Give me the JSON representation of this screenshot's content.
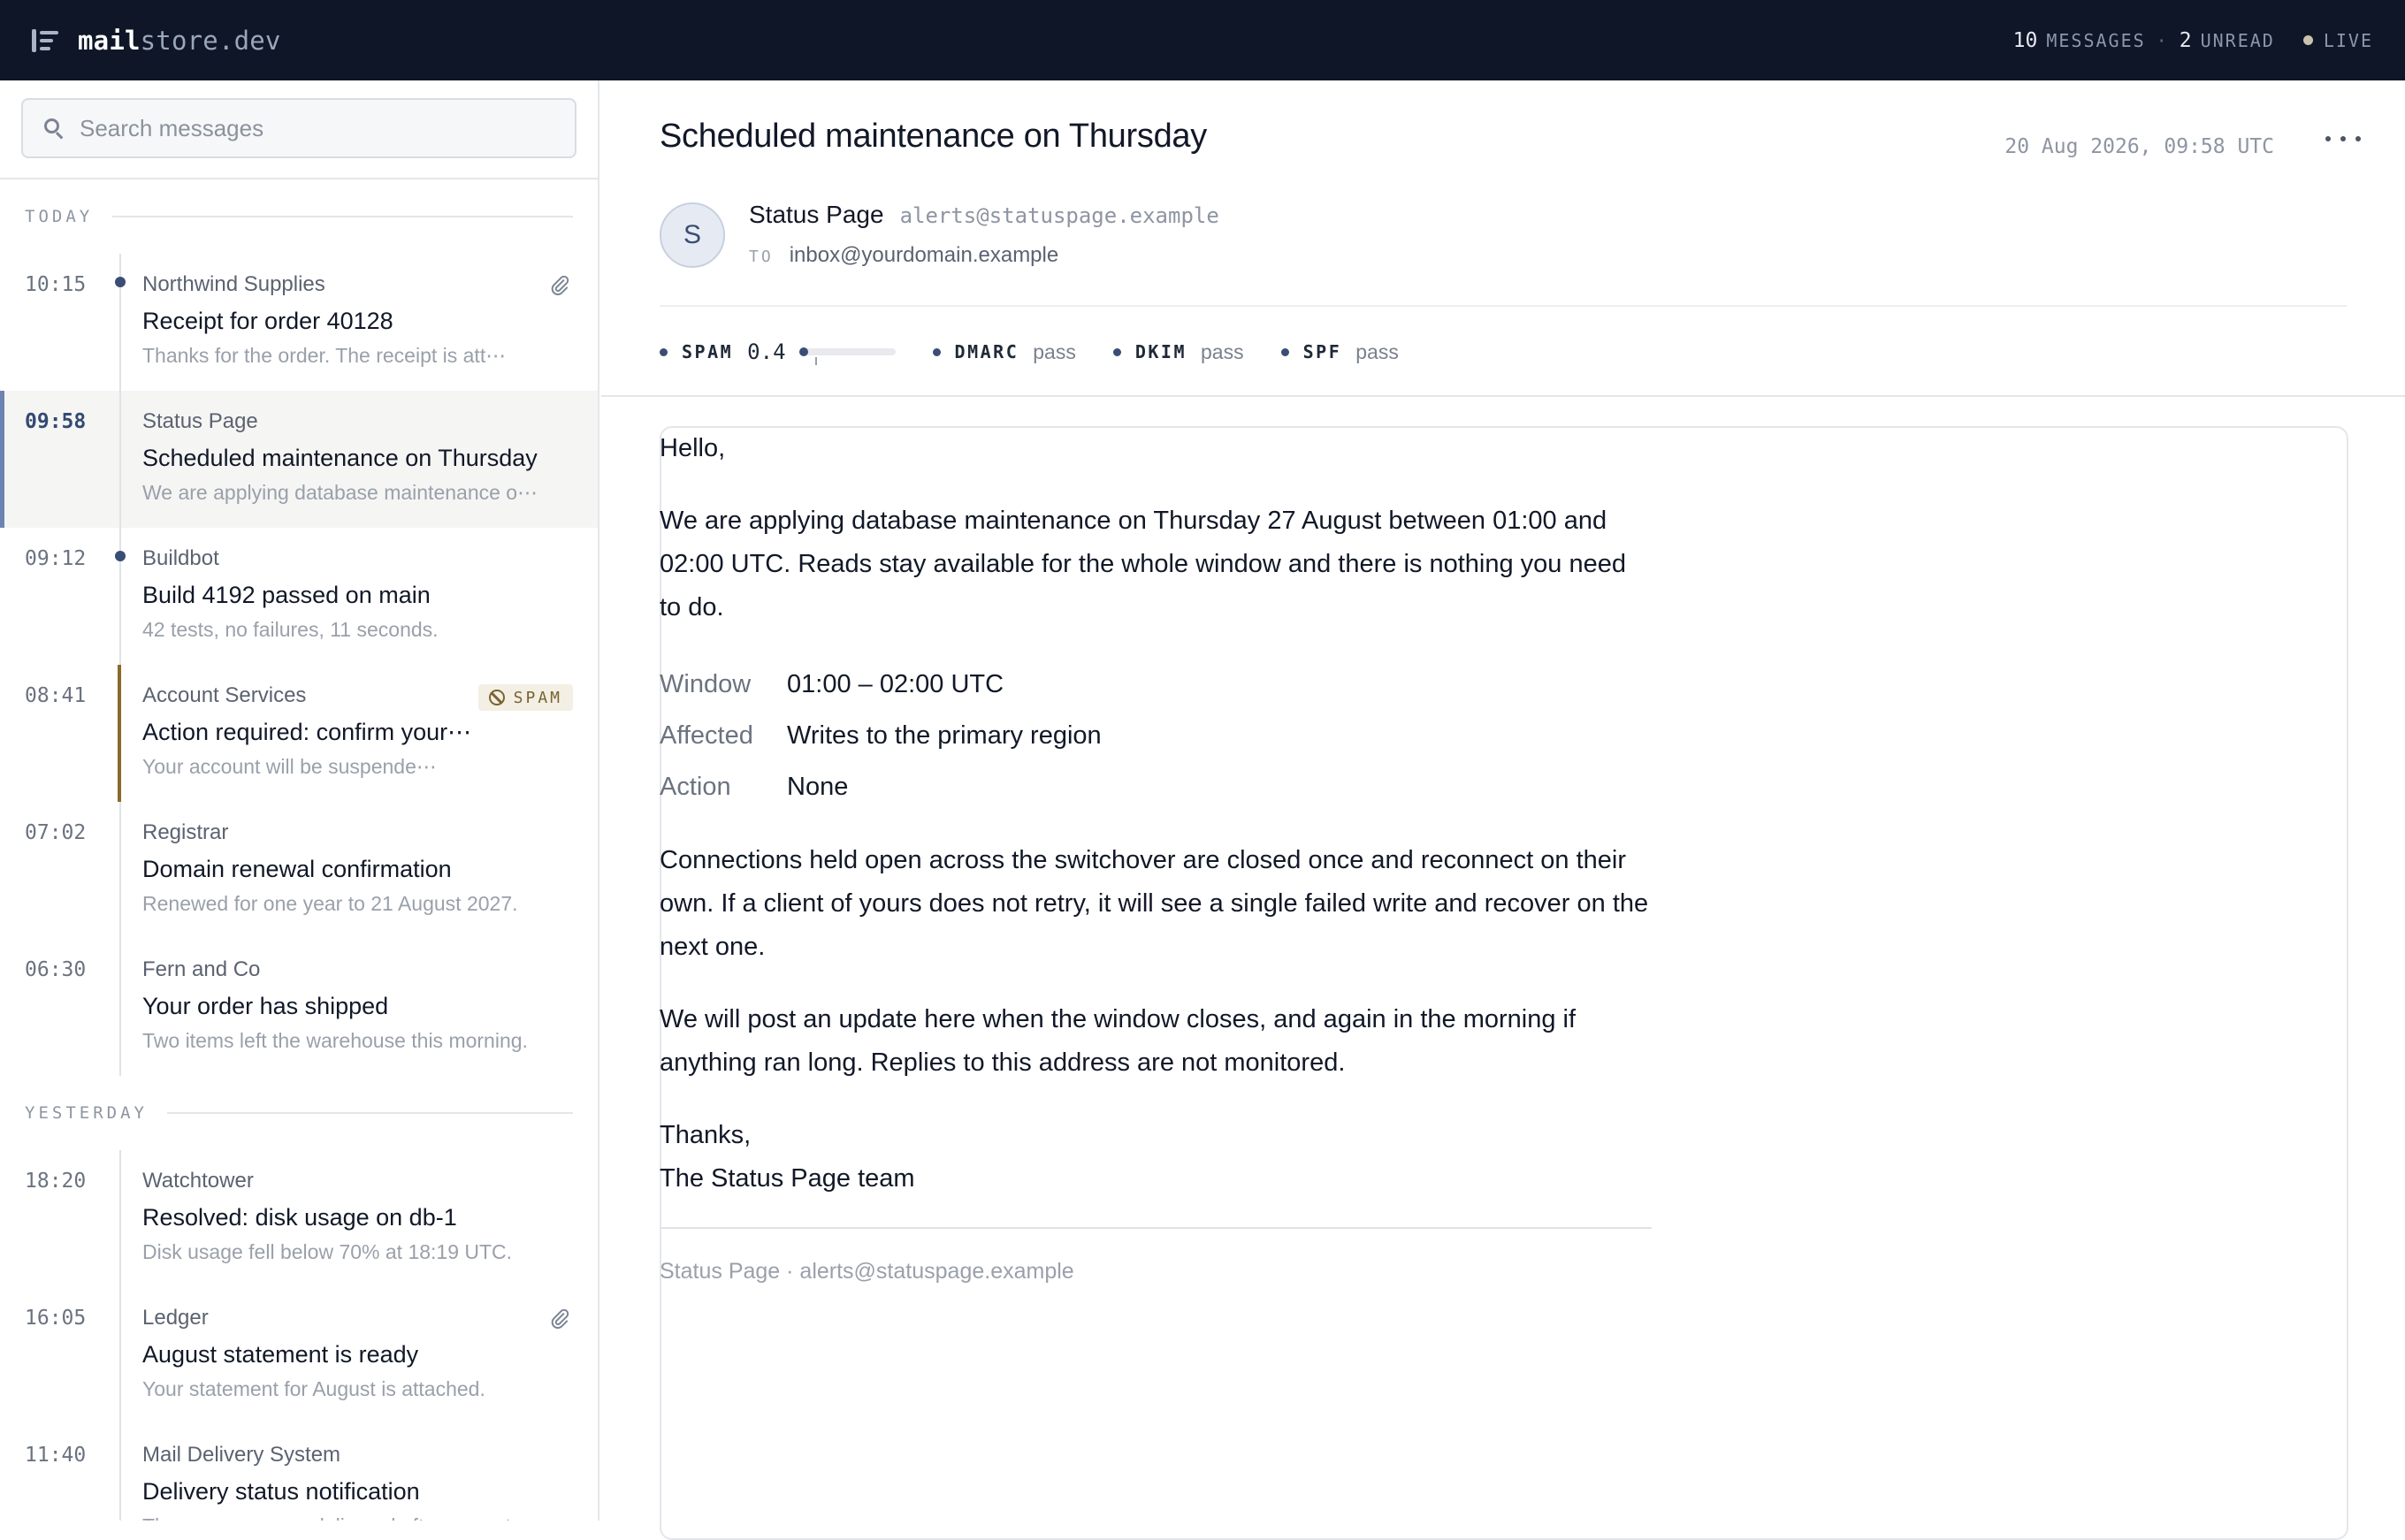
{
  "app": {
    "brand_part1": "mail",
    "brand_part2": "store.dev",
    "message_count": "10",
    "messages_label": "MESSAGES",
    "unread_count": "2",
    "unread_label": "UNREAD",
    "live_label": "LIVE",
    "icons": {
      "logo": "list-logo-icon",
      "live": "live-status-dot-icon"
    }
  },
  "search": {
    "placeholder": "Search messages",
    "value": "",
    "icon": "search-icon"
  },
  "groups": [
    {
      "label": "TODAY",
      "items": [
        {
          "time": "10:15",
          "sender": "Northwind Supplies",
          "subject": "Receipt for order 40128",
          "preview": "Thanks for the order. The receipt is att⋯",
          "unread": true,
          "attachment": true
        },
        {
          "time": "09:58",
          "sender": "Status Page",
          "subject": "Scheduled maintenance on Thursday",
          "preview": "We are applying database maintenance o⋯",
          "selected": true
        },
        {
          "time": "09:12",
          "sender": "Buildbot",
          "subject": "Build 4192 passed on main",
          "preview": "42 tests, no failures, 11 seconds.",
          "unread": true
        },
        {
          "time": "08:41",
          "sender": "Account Services",
          "subject": "Action required: confirm your⋯",
          "preview": "Your account will be suspende⋯",
          "spam": true,
          "badge": "SPAM"
        },
        {
          "time": "07:02",
          "sender": "Registrar",
          "subject": "Domain renewal confirmation",
          "preview": "Renewed for one year to 21 August 2027."
        },
        {
          "time": "06:30",
          "sender": "Fern and Co",
          "subject": "Your order has shipped",
          "preview": "Two items left the warehouse this morning."
        }
      ]
    },
    {
      "label": "YESTERDAY",
      "items": [
        {
          "time": "18:20",
          "sender": "Watchtower",
          "subject": "Resolved: disk usage on db-1",
          "preview": "Disk usage fell below 70% at 18:19 UTC."
        },
        {
          "time": "16:05",
          "sender": "Ledger",
          "subject": "August statement is ready",
          "preview": "Your statement for August is attached.",
          "attachment": true
        },
        {
          "time": "11:40",
          "sender": "Mail Delivery System",
          "subject": "Delivery status notification",
          "preview": "The message was delivered after one retry."
        }
      ]
    }
  ],
  "message": {
    "title": "Scheduled maintenance on Thursday",
    "date": "20 Aug 2026, 09:58 UTC",
    "avatar_initial": "S",
    "from_name": "Status Page",
    "from_email": "alerts@statuspage.example",
    "to_label": "TO",
    "to_address": "inbox@yourdomain.example",
    "checks": {
      "spam_label": "SPAM",
      "spam_score": "0.4",
      "spam_score_fraction": 0.04,
      "dmarc_label": "DMARC",
      "dmarc_value": "pass",
      "dkim_label": "DKIM",
      "dkim_value": "pass",
      "spf_label": "SPF",
      "spf_value": "pass"
    },
    "body": {
      "greeting": "Hello,",
      "para1": "We are applying database maintenance on Thursday 27 August between 01:00 and 02:00 UTC. Reads stay available for the whole window and there is nothing you need to do.",
      "details": [
        {
          "key": "Window",
          "value": "01:00 – 02:00 UTC"
        },
        {
          "key": "Affected",
          "value": "Writes to the primary region"
        },
        {
          "key": "Action",
          "value": "None"
        }
      ],
      "para2": "Connections held open across the switchover are closed once and reconnect on their own. If a client of yours does not retry, it will see a single failed write and recover on the next one.",
      "para3": "We will post an update here when the window closes, and again in the morning if anything ran long. Replies to this address are not monitored.",
      "signoff1": "Thanks,",
      "signoff2": "The Status Page team",
      "footer": "Status Page · alerts@statuspage.example"
    }
  },
  "colors": {
    "topbar": "#0e1628",
    "accent": "#3a4d74",
    "selected_bar": "#6d84b3",
    "spam": "#7a6331"
  }
}
